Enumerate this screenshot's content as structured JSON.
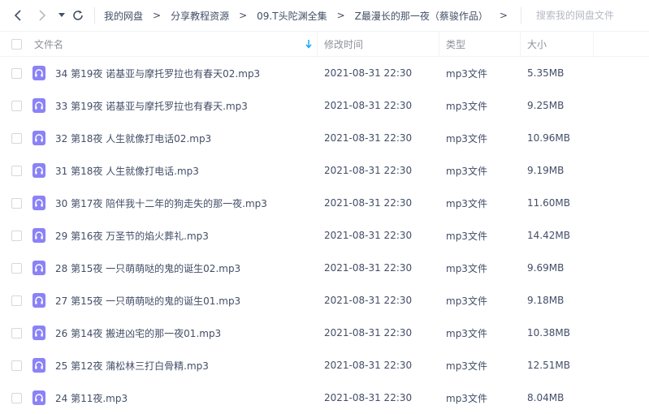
{
  "nav": {
    "back_icon": "chevron-left-icon",
    "forward_icon": "chevron-right-icon",
    "history_icon": "caret-down-icon",
    "refresh_icon": "refresh-icon"
  },
  "breadcrumb": {
    "items": [
      "我的网盘",
      "分享教程资源",
      "09.T头陀渊全集",
      "Z最漫长的那一夜（蔡骏作品）"
    ],
    "separator": ">"
  },
  "search": {
    "placeholder": "搜索我的网盘文件"
  },
  "columns": {
    "name": "文件名",
    "modified": "修改时间",
    "type": "类型",
    "size": "大小"
  },
  "colors": {
    "accent": "#06a7ff",
    "file_icon": "#8b82f6"
  },
  "files": [
    {
      "name": "34 第19夜 诺基亚与摩托罗拉也有春天02.mp3",
      "modified": "2021-08-31 22:30",
      "type": "mp3文件",
      "size": "5.35MB"
    },
    {
      "name": "33 第19夜 诺基亚与摩托罗拉也有春天.mp3",
      "modified": "2021-08-31 22:30",
      "type": "mp3文件",
      "size": "9.25MB"
    },
    {
      "name": "32 第18夜 人生就像打电话02.mp3",
      "modified": "2021-08-31 22:30",
      "type": "mp3文件",
      "size": "10.96MB"
    },
    {
      "name": "31 第18夜 人生就像打电话.mp3",
      "modified": "2021-08-31 22:30",
      "type": "mp3文件",
      "size": "9.19MB"
    },
    {
      "name": "30 第17夜 陪伴我十二年的狗走失的那一夜.mp3",
      "modified": "2021-08-31 22:30",
      "type": "mp3文件",
      "size": "11.60MB"
    },
    {
      "name": "29 第16夜 万圣节的焰火葬礼.mp3",
      "modified": "2021-08-31 22:30",
      "type": "mp3文件",
      "size": "14.42MB"
    },
    {
      "name": "28 第15夜 一只萌萌哒的鬼的诞生02.mp3",
      "modified": "2021-08-31 22:30",
      "type": "mp3文件",
      "size": "9.69MB"
    },
    {
      "name": "27 第15夜 一只萌萌哒的鬼的诞生01.mp3",
      "modified": "2021-08-31 22:30",
      "type": "mp3文件",
      "size": "9.18MB"
    },
    {
      "name": "26 第14夜 搬进凶宅的那一夜01.mp3",
      "modified": "2021-08-31 22:30",
      "type": "mp3文件",
      "size": "10.38MB"
    },
    {
      "name": "25 第12夜 蒲松林三打白骨精.mp3",
      "modified": "2021-08-31 22:30",
      "type": "mp3文件",
      "size": "12.51MB"
    },
    {
      "name": "24 第11夜.mp3",
      "modified": "2021-08-31 22:30",
      "type": "mp3文件",
      "size": "8.04MB"
    }
  ]
}
